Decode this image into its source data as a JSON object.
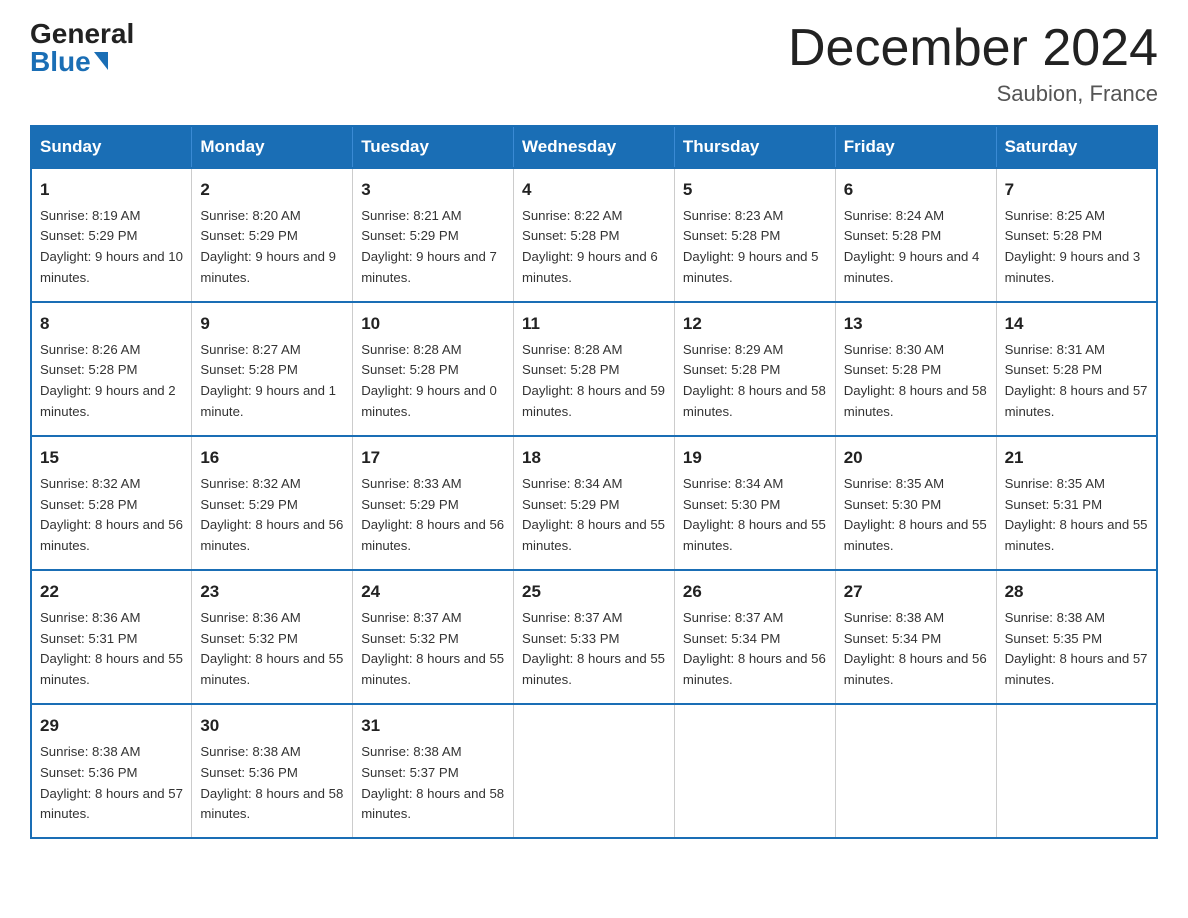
{
  "logo": {
    "general": "General",
    "blue": "Blue"
  },
  "title": {
    "month_year": "December 2024",
    "location": "Saubion, France"
  },
  "weekdays": [
    "Sunday",
    "Monday",
    "Tuesday",
    "Wednesday",
    "Thursday",
    "Friday",
    "Saturday"
  ],
  "weeks": [
    [
      {
        "day": "1",
        "sunrise": "8:19 AM",
        "sunset": "5:29 PM",
        "daylight": "9 hours and 10 minutes."
      },
      {
        "day": "2",
        "sunrise": "8:20 AM",
        "sunset": "5:29 PM",
        "daylight": "9 hours and 9 minutes."
      },
      {
        "day": "3",
        "sunrise": "8:21 AM",
        "sunset": "5:29 PM",
        "daylight": "9 hours and 7 minutes."
      },
      {
        "day": "4",
        "sunrise": "8:22 AM",
        "sunset": "5:28 PM",
        "daylight": "9 hours and 6 minutes."
      },
      {
        "day": "5",
        "sunrise": "8:23 AM",
        "sunset": "5:28 PM",
        "daylight": "9 hours and 5 minutes."
      },
      {
        "day": "6",
        "sunrise": "8:24 AM",
        "sunset": "5:28 PM",
        "daylight": "9 hours and 4 minutes."
      },
      {
        "day": "7",
        "sunrise": "8:25 AM",
        "sunset": "5:28 PM",
        "daylight": "9 hours and 3 minutes."
      }
    ],
    [
      {
        "day": "8",
        "sunrise": "8:26 AM",
        "sunset": "5:28 PM",
        "daylight": "9 hours and 2 minutes."
      },
      {
        "day": "9",
        "sunrise": "8:27 AM",
        "sunset": "5:28 PM",
        "daylight": "9 hours and 1 minute."
      },
      {
        "day": "10",
        "sunrise": "8:28 AM",
        "sunset": "5:28 PM",
        "daylight": "9 hours and 0 minutes."
      },
      {
        "day": "11",
        "sunrise": "8:28 AM",
        "sunset": "5:28 PM",
        "daylight": "8 hours and 59 minutes."
      },
      {
        "day": "12",
        "sunrise": "8:29 AM",
        "sunset": "5:28 PM",
        "daylight": "8 hours and 58 minutes."
      },
      {
        "day": "13",
        "sunrise": "8:30 AM",
        "sunset": "5:28 PM",
        "daylight": "8 hours and 58 minutes."
      },
      {
        "day": "14",
        "sunrise": "8:31 AM",
        "sunset": "5:28 PM",
        "daylight": "8 hours and 57 minutes."
      }
    ],
    [
      {
        "day": "15",
        "sunrise": "8:32 AM",
        "sunset": "5:28 PM",
        "daylight": "8 hours and 56 minutes."
      },
      {
        "day": "16",
        "sunrise": "8:32 AM",
        "sunset": "5:29 PM",
        "daylight": "8 hours and 56 minutes."
      },
      {
        "day": "17",
        "sunrise": "8:33 AM",
        "sunset": "5:29 PM",
        "daylight": "8 hours and 56 minutes."
      },
      {
        "day": "18",
        "sunrise": "8:34 AM",
        "sunset": "5:29 PM",
        "daylight": "8 hours and 55 minutes."
      },
      {
        "day": "19",
        "sunrise": "8:34 AM",
        "sunset": "5:30 PM",
        "daylight": "8 hours and 55 minutes."
      },
      {
        "day": "20",
        "sunrise": "8:35 AM",
        "sunset": "5:30 PM",
        "daylight": "8 hours and 55 minutes."
      },
      {
        "day": "21",
        "sunrise": "8:35 AM",
        "sunset": "5:31 PM",
        "daylight": "8 hours and 55 minutes."
      }
    ],
    [
      {
        "day": "22",
        "sunrise": "8:36 AM",
        "sunset": "5:31 PM",
        "daylight": "8 hours and 55 minutes."
      },
      {
        "day": "23",
        "sunrise": "8:36 AM",
        "sunset": "5:32 PM",
        "daylight": "8 hours and 55 minutes."
      },
      {
        "day": "24",
        "sunrise": "8:37 AM",
        "sunset": "5:32 PM",
        "daylight": "8 hours and 55 minutes."
      },
      {
        "day": "25",
        "sunrise": "8:37 AM",
        "sunset": "5:33 PM",
        "daylight": "8 hours and 55 minutes."
      },
      {
        "day": "26",
        "sunrise": "8:37 AM",
        "sunset": "5:34 PM",
        "daylight": "8 hours and 56 minutes."
      },
      {
        "day": "27",
        "sunrise": "8:38 AM",
        "sunset": "5:34 PM",
        "daylight": "8 hours and 56 minutes."
      },
      {
        "day": "28",
        "sunrise": "8:38 AM",
        "sunset": "5:35 PM",
        "daylight": "8 hours and 57 minutes."
      }
    ],
    [
      {
        "day": "29",
        "sunrise": "8:38 AM",
        "sunset": "5:36 PM",
        "daylight": "8 hours and 57 minutes."
      },
      {
        "day": "30",
        "sunrise": "8:38 AM",
        "sunset": "5:36 PM",
        "daylight": "8 hours and 58 minutes."
      },
      {
        "day": "31",
        "sunrise": "8:38 AM",
        "sunset": "5:37 PM",
        "daylight": "8 hours and 58 minutes."
      },
      null,
      null,
      null,
      null
    ]
  ],
  "labels": {
    "sunrise": "Sunrise:",
    "sunset": "Sunset:",
    "daylight": "Daylight:"
  }
}
